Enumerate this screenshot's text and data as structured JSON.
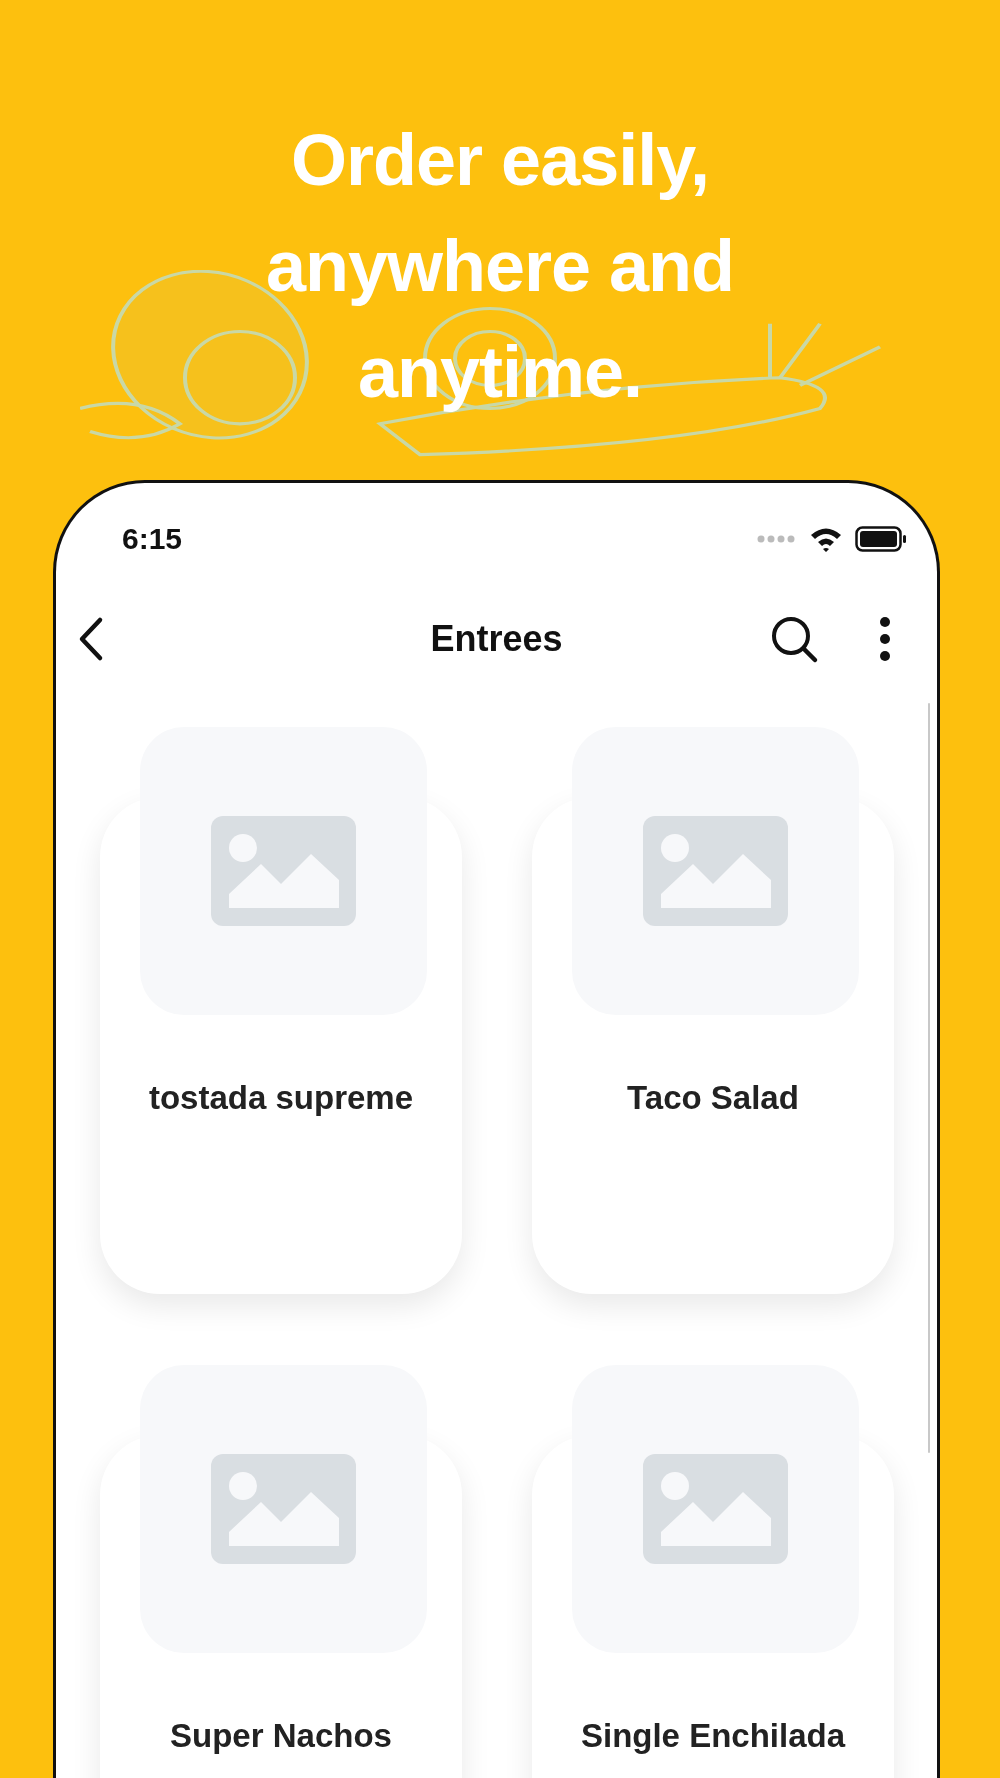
{
  "headline": [
    "Order easily,",
    "anywhere and",
    "anytime."
  ],
  "status_bar": {
    "time": "6:15"
  },
  "nav": {
    "title": "Entrees"
  },
  "items": [
    {
      "name": "tostada supreme"
    },
    {
      "name": "Taco Salad"
    },
    {
      "name": "Super Nachos"
    },
    {
      "name": "Single Enchilada"
    }
  ]
}
